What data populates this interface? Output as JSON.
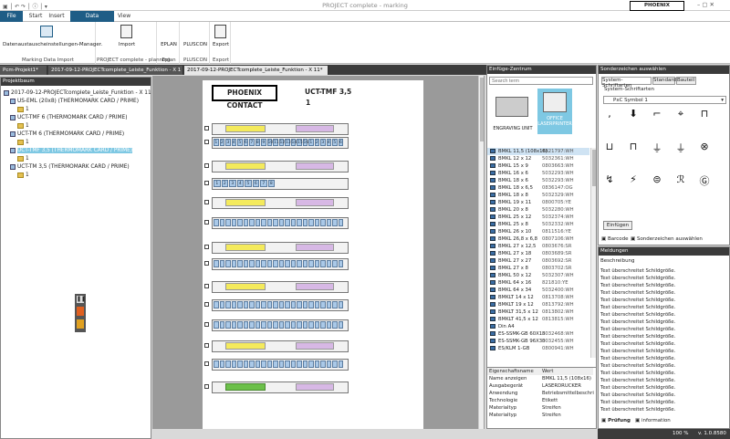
{
  "window": {
    "title": "PROJECT complete - marking",
    "logo": "PHOENIX CONTACT"
  },
  "ribbon_tabs": [
    "File",
    "Start",
    "Insert",
    "Data Interchange",
    "View"
  ],
  "ribbon": {
    "btn_datenaustausch": "Datenaustauscheinstellungen-Manager.",
    "grp_marking": "Marking Data Import",
    "btn_import": "Import",
    "grp_planning": "PROJECT complete - planning",
    "btn_eplan": "EPLAN",
    "grp_eplan": "Eplan",
    "btn_pluscon": "PLUSCON",
    "grp_pluscon": "PLUSCON",
    "btn_export": "Export",
    "grp_export": "Export"
  },
  "doc_tabs": [
    "Pcm-Projekt1*",
    "2017-09-12-PROJECTcomplete_Leiste_Funktion - X 1",
    "2017-09-12-PROJECTcomplete_Leiste_Funktion - X 11*"
  ],
  "project_tree": {
    "header": "Projektbaum",
    "items": [
      {
        "label": "2017-09-12-PROJECTcomplete_Leiste_Funktion - X 11",
        "level": 0
      },
      {
        "label": "US-EML (20x8) (THERMOMARK CARD / PRIME)",
        "level": 1
      },
      {
        "label": "1",
        "level": 2
      },
      {
        "label": "UCT-TMF 6 (THERMOMARK CARD / PRIME)",
        "level": 1
      },
      {
        "label": "1",
        "level": 2
      },
      {
        "label": "UCT-TM 6 (THERMOMARK CARD / PRIME)",
        "level": 1
      },
      {
        "label": "1",
        "level": 2
      },
      {
        "label": "UCT-TMF 3,5 (THERMOMARK CARD / PRIME)",
        "level": 1,
        "selected": true
      },
      {
        "label": "1",
        "level": 2
      },
      {
        "label": "UCT-TM 3,5 (THERMOMARK CARD / PRIME)",
        "level": 1
      },
      {
        "label": "1",
        "level": 2
      }
    ]
  },
  "sheet": {
    "logo": "PHOENIX CONTACT",
    "title": "UCT-TMF 3,5",
    "page": "1"
  },
  "insert_center": {
    "header": "Einfüge-Zentrum",
    "search_placeholder": "Search term",
    "devices": [
      "ENGRAVING UNIT",
      "OFFICE LASERPRINTER"
    ],
    "items": [
      [
        "BMKL 11,5 (108x16)",
        "0821797:WH"
      ],
      [
        "BMKL 12 x 12",
        "5032361:WH"
      ],
      [
        "BMKL 15 x 9",
        "0803663:WH"
      ],
      [
        "BMKL 16 x 6",
        "5032293:WH"
      ],
      [
        "BMKL 18 x 6",
        "5032293:WH"
      ],
      [
        "BMKL 18 x 6,5",
        "0836147:OG"
      ],
      [
        "BMKL 18 x 8",
        "5032329:WH"
      ],
      [
        "BMKL 19 x 11",
        "0800705:YE"
      ],
      [
        "BMKL 20 x 8",
        "5032280:WH"
      ],
      [
        "BMKL 25 x 12",
        "5032374:WH"
      ],
      [
        "BMKL 25 x 8",
        "5032332:WH"
      ],
      [
        "BMKL 26 x 10",
        "0811516:YE"
      ],
      [
        "BMKL 26,8 x 6,8",
        "0807106:WH"
      ],
      [
        "BMKL 27 x 12,5",
        "0803676:SR"
      ],
      [
        "BMKL 27 x 18",
        "0803689:SR"
      ],
      [
        "BMKL 27 x 27",
        "0803692:SR"
      ],
      [
        "BMKL 27 x 8",
        "0803702:SR"
      ],
      [
        "BMKL 50 x 12",
        "5032307:WH"
      ],
      [
        "BMKL 64 x 16",
        "821810:YE"
      ],
      [
        "BMKL 64 x 34",
        "5032400:WH"
      ],
      [
        "BMKLT 14 x 12",
        "0813708:WH"
      ],
      [
        "BMKLT 19 x 12",
        "0813792:WH"
      ],
      [
        "BMKLT 31,5 x 12",
        "0813802:WH"
      ],
      [
        "BMKLT 41,5 x 12",
        "0813815:WH"
      ],
      [
        "Din A4",
        ""
      ],
      [
        "ES-SSMK-GB 60X18",
        "5032468:WH"
      ],
      [
        "ES-SSMK-GB 96X30",
        "5032455:WH"
      ],
      [
        "ES/KLM 1-GB",
        "0800941:WH"
      ]
    ]
  },
  "properties": {
    "col_name": "Eigenschaftsname",
    "col_value": "Wert",
    "rows": [
      [
        "Name anzeigen",
        "BMKL 11,5 (108x16)"
      ],
      [
        "Ausgabegerät",
        "LASERDRUCKER"
      ],
      [
        "Anwendung",
        "Betriebsmittelbeschri"
      ],
      [
        "Technologie",
        "Etikett"
      ],
      [
        "Materialtyp",
        "Streifen"
      ],
      [
        "Materialtyp",
        "Streifen"
      ]
    ]
  },
  "special_chars": {
    "header": "Sonderzeichen auswählen",
    "tabs": [
      "System-Schriftarten",
      "Standard",
      "Bauteil"
    ],
    "subtab": "System-Schriftarten",
    "font": "PxC Symbol 1",
    "insert_button": "Einfügen",
    "bottom_tabs": [
      "Barcode",
      "Sonderzeichen auswählen"
    ],
    "symbols": [
      ",",
      "⬇",
      "⌐",
      "⌖",
      "⊓",
      "⊔",
      "⊓",
      "⏚",
      "⏚",
      "⊗",
      "↯",
      "⚡",
      "⊜",
      "ℛ",
      "Ⓖ"
    ]
  },
  "messages": {
    "header": "Meldungen",
    "col": "Beschreibung",
    "rows": [
      "Text überschreitet Schildgröße.",
      "Text überschreitet Schildgröße.",
      "Text überschreitet Schildgröße.",
      "Text überschreitet Schildgröße.",
      "Text überschreitet Schildgröße.",
      "Text überschreitet Schildgröße.",
      "Text überschreitet Schildgröße.",
      "Text überschreitet Schildgröße.",
      "Text überschreitet Schildgröße.",
      "Text überschreitet Schildgröße.",
      "Text überschreitet Schildgröße.",
      "Text überschreitet Schildgröße.",
      "Text überschreitet Schildgröße.",
      "Text überschreitet Schildgröße.",
      "Text überschreitet Schildgröße.",
      "Text überschreitet Schildgröße.",
      "Text überschreitet Schildgröße.",
      "Text überschreitet Schildgröße.",
      "Text überschreitet Schildgröße.",
      "Text überschreitet Schildgröße."
    ],
    "tabs": [
      "Prüfung",
      "information"
    ]
  },
  "status": {
    "zoom": "100 %",
    "version": "v. 1.0.8580"
  },
  "numbered_cells_row1": [
    "1",
    "2",
    "3",
    "4",
    "5",
    "6",
    "7",
    "8",
    "9",
    "10",
    "11",
    "12",
    "13",
    "14",
    "15",
    "16",
    "1",
    "2",
    "3",
    "4",
    "5",
    "6"
  ],
  "numbered_cells_row2": [
    "1",
    "2",
    "3",
    "4",
    "5",
    "6",
    "7",
    "8"
  ]
}
